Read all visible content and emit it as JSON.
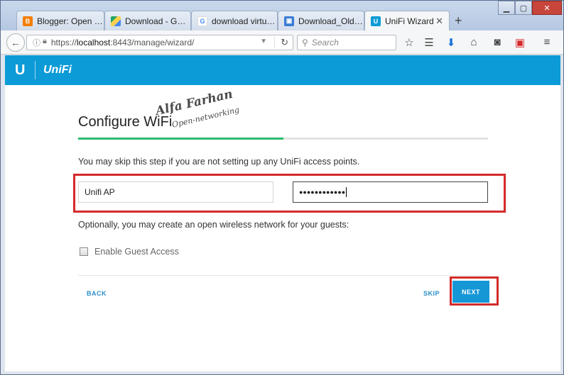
{
  "browser": {
    "tabs": [
      {
        "label": "Blogger: Open N...",
        "favicon": "blogger-icon",
        "color": "#f57d00"
      },
      {
        "label": "Download - Goo...",
        "favicon": "google-drive-icon",
        "color": "#1fa463"
      },
      {
        "label": "download virtua...",
        "favicon": "google-icon",
        "color": "#4285f4"
      },
      {
        "label": "Download_Old_...",
        "favicon": "image-file-icon",
        "color": "#3a7bd5"
      },
      {
        "label": "UniFi Wizard",
        "favicon": "unifi-icon",
        "color": "#0c9bd7"
      }
    ],
    "url_scheme": "https://",
    "url_host": "localhost",
    "url_rest": ":8443/manage/wizard/",
    "search_placeholder": "Search"
  },
  "app": {
    "brand": "UniFi",
    "accent_color": "#0c9bd7"
  },
  "wizard": {
    "title": "Configure WiFi",
    "progress": 0.5,
    "skip_note": "You may skip this step if you are not setting up any UniFi access points.",
    "ssid_value": "Unifi AP",
    "password_value": "●●●●●●●●●●●●",
    "optional_note": "Optionally, you may create an open wireless network for your guests:",
    "guest_label": "Enable Guest Access",
    "guest_checked": false,
    "back_label": "BACK",
    "skip_label": "SKIP",
    "next_label": "NEXT"
  },
  "watermark": {
    "name": "Alfa Farhan",
    "subtitle": "Open-networking"
  }
}
